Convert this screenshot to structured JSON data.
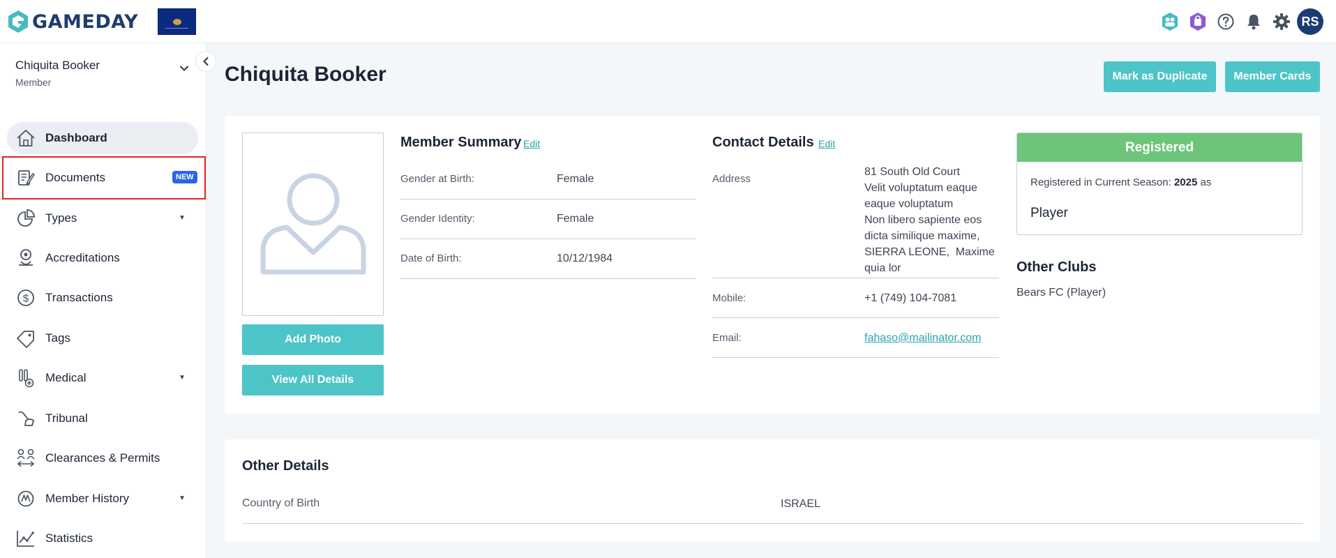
{
  "header": {
    "brand": "GAMEDAY",
    "avatar_initials": "RS",
    "icons": [
      "connect-icon",
      "store-icon",
      "help-icon",
      "bell-icon",
      "settings-icon"
    ]
  },
  "sidebar": {
    "member_name": "Chiquita Booker",
    "member_role": "Member",
    "items": [
      {
        "label": "Dashboard",
        "icon": "home-icon",
        "active": true
      },
      {
        "label": "Documents",
        "icon": "document-edit-icon",
        "badge": "NEW"
      },
      {
        "label": "Types",
        "icon": "pie-chart-icon",
        "has_submenu": true
      },
      {
        "label": "Accreditations",
        "icon": "accreditation-icon"
      },
      {
        "label": "Transactions",
        "icon": "dollar-icon"
      },
      {
        "label": "Tags",
        "icon": "tag-icon"
      },
      {
        "label": "Medical",
        "icon": "medical-icon",
        "has_submenu": true
      },
      {
        "label": "Tribunal",
        "icon": "tribunal-icon"
      },
      {
        "label": "Clearances & Permits",
        "icon": "clearances-icon"
      },
      {
        "label": "Member History",
        "icon": "history-icon",
        "has_submenu": true
      },
      {
        "label": "Statistics",
        "icon": "statistics-icon"
      }
    ]
  },
  "main": {
    "title": "Chiquita Booker",
    "buttons": {
      "duplicate": "Mark as Duplicate",
      "member_cards": "Member Cards"
    },
    "photo": {
      "add": "Add Photo",
      "view_all": "View All Details"
    },
    "member_summary": {
      "title": "Member Summary",
      "edit": "Edit",
      "rows": [
        {
          "label": "Gender at Birth:",
          "value": "Female"
        },
        {
          "label": "Gender Identity:",
          "value": "Female"
        },
        {
          "label": "Date of Birth:",
          "value": "10/12/1984"
        }
      ]
    },
    "contact_details": {
      "title": "Contact Details",
      "edit": "Edit",
      "address_label": "Address",
      "address_lines": [
        "81 South Old Court",
        "Velit voluptatum eaque",
        "eaque voluptatum",
        "Non libero sapiente eos",
        "dicta similique maxime,",
        "SIERRA LEONE,  Maxime",
        "quia lor"
      ],
      "mobile_label": "Mobile:",
      "mobile": "+1 (749) 104-7081",
      "email_label": "Email:",
      "email": "fahaso@mailinator.com"
    },
    "registration": {
      "status": "Registered",
      "season_text": "Registered in Current Season:",
      "season": "2025",
      "as_text": "as",
      "role": "Player"
    },
    "other_clubs": {
      "title": "Other Clubs",
      "value": "Bears FC (Player)"
    },
    "other_details": {
      "title": "Other Details",
      "label": "Country of Birth",
      "value": "ISRAEL"
    }
  },
  "colors": {
    "accent": "#4dc4c8",
    "brand_navy": "#1c3b73",
    "registered_green": "#6cc579",
    "new_badge": "#2966e8",
    "highlight": "#e0241f"
  }
}
